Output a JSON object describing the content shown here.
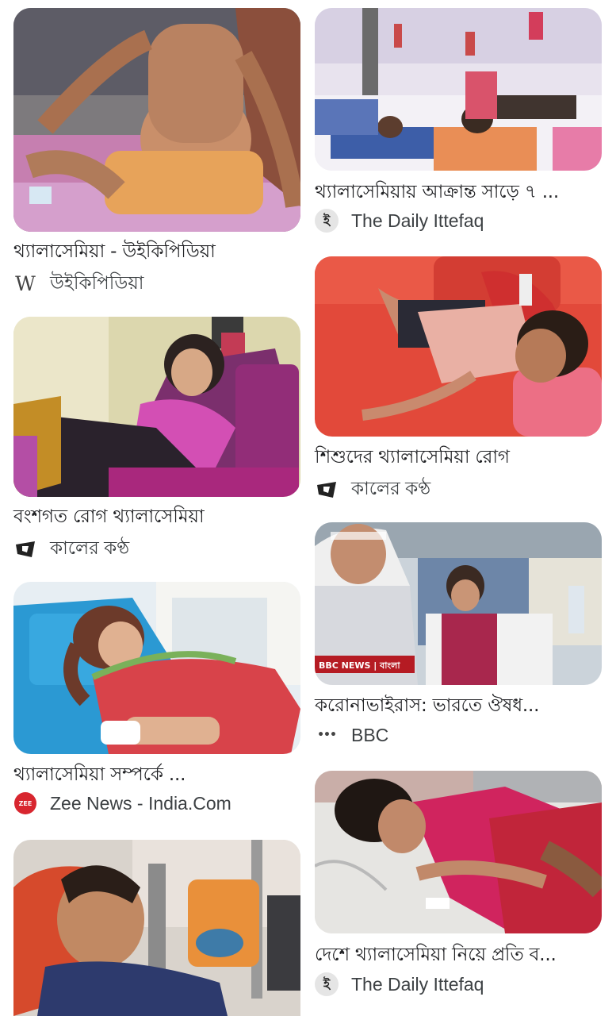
{
  "results": [
    {
      "title": "থ্যালাসেমিয়া - উইকিপিডিয়া",
      "source": "উইকিপিডিয়া",
      "icon": "wikipedia-icon",
      "glyph": "W",
      "accent": "#e7a35a"
    },
    {
      "title": "থ্যালাসেমিয়ায় আক্রান্ত সাড়ে ৭ ...",
      "source": "The Daily Ittefaq",
      "icon": "daily-ittefaq-icon",
      "glyph": "ই",
      "accent": "#d8d0e6"
    },
    {
      "title": "শিশুদের থ্যালাসেমিয়া রোগ",
      "source": "কালের কণ্ঠ",
      "icon": "kaler-kantho-icon",
      "glyph": "ক",
      "accent": "#e2493a"
    },
    {
      "title": "বংশগত রোগ থ্যালাসেমিয়া",
      "source": "কালের কণ্ঠ",
      "icon": "kaler-kantho-icon",
      "glyph": "ক",
      "accent": "#a4226e"
    },
    {
      "title": "করোনাভাইরাস: ভারতে ঔষধ...",
      "source": "BBC",
      "icon": "bbc-icon",
      "glyph": "•••",
      "accent": "#6d86a8",
      "overlay": "BBC NEWS | বাংলা"
    },
    {
      "title": "থ্যালাসেমিয়া সম্পর্কে ...",
      "source": "Zee News - India.Com",
      "icon": "zee-news-icon",
      "glyph": "ZEE",
      "accent": "#d63140"
    },
    {
      "title": "দেশে থ্যালাসেমিয়া নিয়ে প্রতি ব...",
      "source": "The Daily Ittefaq",
      "icon": "daily-ittefaq-icon",
      "glyph": "ই",
      "accent": "#d0245e"
    },
    {
      "title": "",
      "source": "",
      "icon": "",
      "glyph": "",
      "accent": "#e9903a"
    }
  ]
}
